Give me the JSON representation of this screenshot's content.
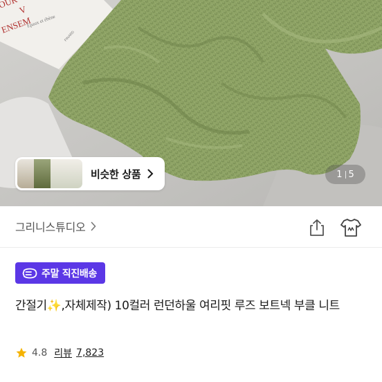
{
  "hero": {
    "book_lines": [
      "OUR",
      "V",
      "ENSEM",
      "Épaux et ébène",
      "FINARD"
    ],
    "similar_products_label": "비슷한 상품",
    "image_counter": {
      "current": "1",
      "total": "5"
    },
    "colors": {
      "sweater": "#8fa466",
      "background": "#c4c3c0"
    }
  },
  "store": {
    "name": "그리니스튜디오"
  },
  "badge": {
    "label": "주말 직진배송",
    "color": "#5b37e6"
  },
  "product": {
    "title": "간절기✨,자체제작) 10컬러 런던하울 여리핏 루즈 보트넥 부클 니트"
  },
  "rating": {
    "value": "4.8",
    "review_label": "리뷰",
    "review_count": "7,823",
    "star_color": "#f5b301"
  }
}
